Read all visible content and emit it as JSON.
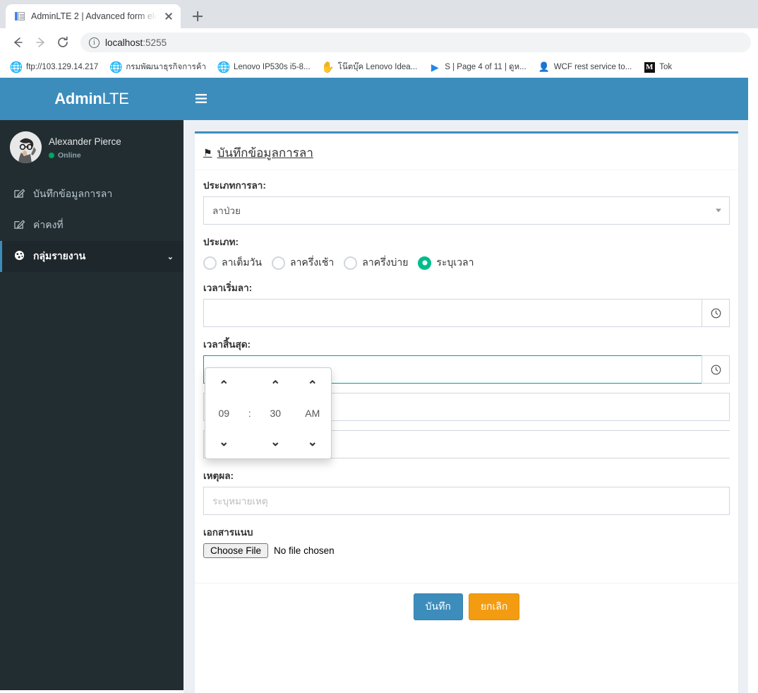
{
  "browser": {
    "tab": {
      "title": "AdminLTE 2 | Advanced form ele",
      "favicon": "document-icon",
      "close": "close-icon"
    },
    "newtab_label": "+",
    "nav": {
      "back": "back-arrow-icon",
      "forward": "forward-arrow-icon",
      "reload": "reload-icon"
    },
    "omnibox": {
      "info_icon": "info-circle-icon",
      "url": "localhost",
      "port": ":5255"
    },
    "bookmarks": [
      {
        "icon": "globe-icon",
        "label": "ftp://103.129.14.217"
      },
      {
        "icon": "globe-icon",
        "label": "กรมพัฒนาธุรกิจการค้า"
      },
      {
        "icon": "globe-icon",
        "label": "Lenovo IP530s i5-8..."
      },
      {
        "icon": "yellow-icon",
        "label": "โน๊ตบุ๊ค Lenovo Idea..."
      },
      {
        "icon": "play-icon",
        "label": "S | Page 4 of 11 | ดูห..."
      },
      {
        "icon": "wcf-icon",
        "label": "WCF rest service to..."
      },
      {
        "icon": "m-icon",
        "label": "Tok"
      }
    ]
  },
  "app": {
    "logo": {
      "bold": "Admin",
      "light": "LTE"
    },
    "navbar": {
      "toggle_icon": "hamburger-icon"
    },
    "user": {
      "name": "Alexander Pierce",
      "status": "Online",
      "avatar": "user-avatar"
    },
    "menu": [
      {
        "icon": "edit-icon",
        "label": "บันทึกข้อมูลการลา",
        "active": false,
        "caret": ""
      },
      {
        "icon": "edit-icon",
        "label": "ค่าคงที่",
        "active": false,
        "caret": ""
      },
      {
        "icon": "report-icon",
        "label": "กลุ่มรายงาน",
        "active": true,
        "caret": "⌄"
      }
    ]
  },
  "form": {
    "title": "บันทึกข้อมูลการลา",
    "title_icon": "flag-icon",
    "leave_type": {
      "label": "ประเภทการลา:",
      "value": "ลาป่วย",
      "caret": "caret-down-icon"
    },
    "category": {
      "label": "ประเภท:",
      "options": [
        {
          "label": "ลาเต็มวัน",
          "checked": false
        },
        {
          "label": "ลาครึ่งเช้า",
          "checked": false
        },
        {
          "label": "ลาครึ่งบ่าย",
          "checked": false
        },
        {
          "label": "ระบุเวลา",
          "checked": true
        }
      ]
    },
    "start_time": {
      "label": "เวลาเริ่มลา:",
      "value": "",
      "addon_icon": "clock-icon"
    },
    "end_time": {
      "label": "เวลาสิ้นสุด:",
      "value": "",
      "addon_icon": "clock-icon",
      "focused": true
    },
    "timepicker": {
      "hour": "09",
      "separator": ":",
      "minute": "30",
      "meridian": "AM",
      "up_icon": "chevron-up-icon",
      "down_icon": "chevron-down-icon"
    },
    "hidden_field": {
      "value": ""
    },
    "date_field": {
      "value": "",
      "addon_icon": "calendar-icon"
    },
    "reason": {
      "label": "เหตุผล:",
      "value": "",
      "placeholder": "ระบุหมายเหตุ"
    },
    "attachment": {
      "label": "เอกสารแนบ",
      "button": "Choose File",
      "status": "No file chosen"
    },
    "buttons": {
      "save": {
        "label": "บันทึก",
        "color": "#3c8dbc"
      },
      "cancel": {
        "label": "ยกเลิก",
        "color": "#f39c12"
      }
    }
  },
  "theme": {
    "primary": "#3c8dbc",
    "sidebar_bg": "#222d32",
    "sidebar_active": "#1e282c",
    "content_bg": "#ecf0f5",
    "accent_green": "#00bc8c",
    "warning": "#f39c12"
  }
}
